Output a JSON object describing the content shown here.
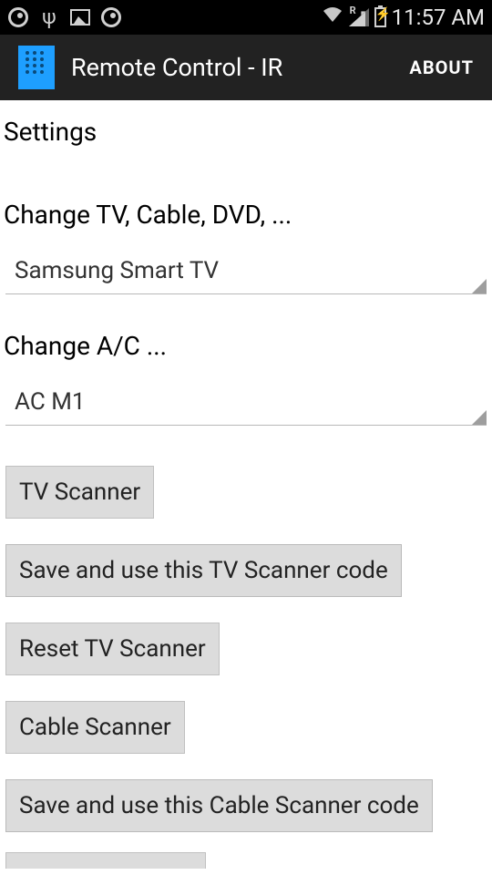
{
  "status_bar": {
    "clock": "11:57 AM",
    "signal_indicator": "R"
  },
  "app_bar": {
    "title": "Remote Control - IR",
    "about_label": "ABOUT"
  },
  "settings": {
    "title": "Settings",
    "tv_label": "Change TV, Cable, DVD, ...",
    "tv_value": "Samsung Smart TV",
    "ac_label": "Change A/C ...",
    "ac_value": "AC M1"
  },
  "buttons": {
    "tv_scanner": "TV Scanner",
    "save_tv": "Save and use this TV Scanner code",
    "reset_tv": "Reset TV Scanner",
    "cable_scanner": "Cable Scanner",
    "save_cable": "Save and use this Cable Scanner code"
  }
}
